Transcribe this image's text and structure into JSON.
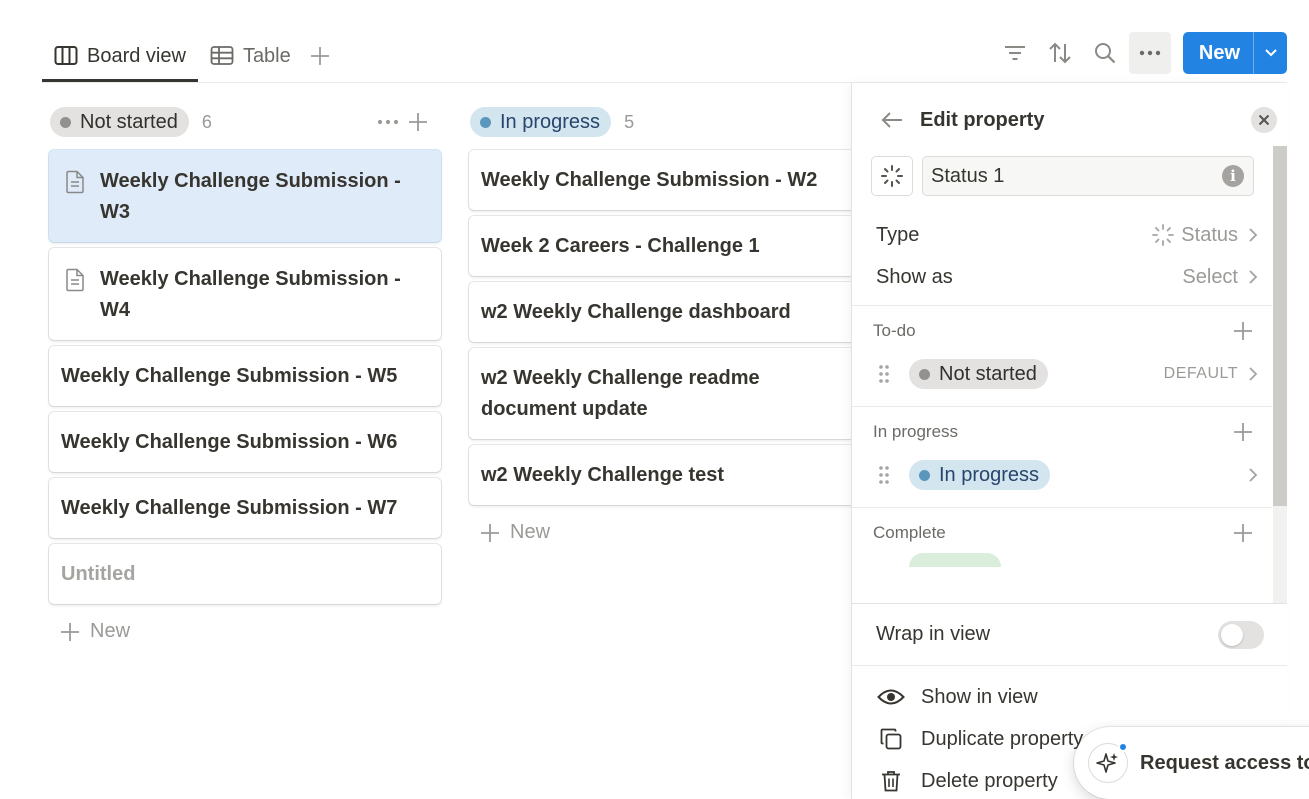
{
  "tabs": [
    {
      "label": "Board view",
      "icon": "board-icon",
      "active": true
    },
    {
      "label": "Table",
      "icon": "table-icon",
      "active": false
    }
  ],
  "toolbar": {
    "new_label": "New",
    "accent": "#2383e2"
  },
  "board": {
    "columns": [
      {
        "status": "Not started",
        "count": "6",
        "color": "#e3e2e0",
        "cards": [
          {
            "title": "Weekly Challenge Submission - W3",
            "has_icon": true,
            "selected": true
          },
          {
            "title": "Weekly Challenge Submission - W4",
            "has_icon": true,
            "selected": false
          },
          {
            "title": "Weekly Challenge Submission - W5",
            "has_icon": false
          },
          {
            "title": "Weekly Challenge Submission - W6",
            "has_icon": false
          },
          {
            "title": "Weekly Challenge Submission - W7",
            "has_icon": false
          },
          {
            "title": "Untitled",
            "has_icon": false,
            "placeholder": true
          }
        ],
        "new_label": "New"
      },
      {
        "status": "In progress",
        "count": "5",
        "color": "#d3e5ef",
        "cards": [
          {
            "title": "Weekly Challenge Submission - W2"
          },
          {
            "title": "Week 2 Careers - Challenge 1"
          },
          {
            "title": "w2 Weekly Challenge dashboard"
          },
          {
            "title": "w2 Weekly Challenge readme document update"
          },
          {
            "title": "w2 Weekly Challenge test"
          }
        ],
        "new_label": "New"
      }
    ]
  },
  "panel": {
    "title": "Edit property",
    "name_value": "Status 1",
    "type_label": "Type",
    "type_value": "Status",
    "show_as_label": "Show as",
    "show_as_value": "Select",
    "groups": [
      {
        "label": "To-do",
        "option": "Not started",
        "meta": "DEFAULT"
      },
      {
        "label": "In progress",
        "option": "In progress",
        "meta": ""
      },
      {
        "label": "Complete"
      }
    ],
    "wrap_label": "Wrap in view",
    "wrap_on": false,
    "actions": [
      {
        "label": "Show in view",
        "icon": "eye-icon"
      },
      {
        "label": "Duplicate property",
        "icon": "duplicate-icon"
      },
      {
        "label": "Delete property",
        "icon": "trash-icon"
      }
    ]
  },
  "request": {
    "label": "Request access to"
  }
}
